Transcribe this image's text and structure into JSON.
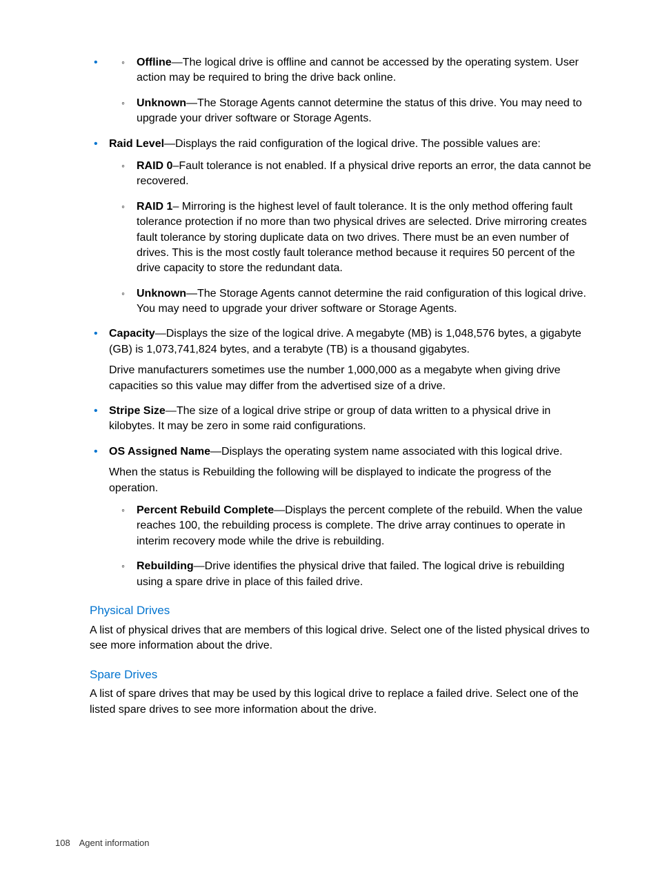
{
  "continuedSubItems": [
    {
      "term": "Offline",
      "desc": "—The logical drive is offline and cannot be accessed by the operating system. User action may be required to bring the drive back online."
    },
    {
      "term": "Unknown",
      "desc": "—The Storage Agents cannot determine the status of this drive. You may need to upgrade your driver software or Storage Agents."
    }
  ],
  "items": [
    {
      "term": "Raid Level",
      "desc": "—Displays the raid configuration of the logical drive. The possible values are:",
      "sub": [
        {
          "term": "RAID 0",
          "desc": "–Fault tolerance is not enabled. If a physical drive reports an error, the data cannot be recovered."
        },
        {
          "term": "RAID 1",
          "desc": "– Mirroring is the highest level of fault tolerance. It is the only method offering fault tolerance protection if no more than two physical drives are selected. Drive mirroring creates fault tolerance by storing duplicate data on two drives. There must be an even number of drives. This is the most costly fault tolerance method because it requires 50 percent of the drive capacity to store the redundant data."
        },
        {
          "term": "Unknown",
          "desc": "—The Storage Agents cannot determine the raid configuration of this logical drive. You may need to upgrade your driver software or Storage Agents."
        }
      ]
    },
    {
      "term": "Capacity",
      "desc": "—Displays the size of the logical drive. A megabyte (MB) is 1,048,576 bytes, a gigabyte (GB) is 1,073,741,824 bytes, and a terabyte (TB) is a thousand gigabytes.",
      "extra": "Drive manufacturers sometimes use the number 1,000,000 as a megabyte when giving drive capacities so this value may differ from the advertised size of a drive."
    },
    {
      "term": "Stripe Size",
      "desc": "—The size of a logical drive stripe or group of data written to a physical drive in kilobytes. It may be zero in some raid configurations."
    },
    {
      "term": "OS Assigned Name",
      "desc": "—Displays the operating system name associated with this logical drive.",
      "extra": "When the status is Rebuilding the following will be displayed to indicate the progress of the operation.",
      "sub": [
        {
          "term": "Percent Rebuild Complete",
          "desc": "—Displays the percent complete of the rebuild. When the value reaches 100, the rebuilding process is complete. The drive array continues to operate in interim recovery mode while the drive is rebuilding."
        },
        {
          "term": "Rebuilding",
          "desc": "—Drive identifies the physical drive that failed. The logical drive is rebuilding using a spare drive in place of this failed drive."
        }
      ]
    }
  ],
  "sections": [
    {
      "heading": "Physical Drives",
      "body": "A list of physical drives that are members of this logical drive. Select one of the listed physical drives to see more information about the drive."
    },
    {
      "heading": "Spare Drives",
      "body": "A list of spare drives that may be used by this logical drive to replace a failed drive. Select one of the listed spare drives to see more information about the drive."
    }
  ],
  "footer": {
    "page": "108",
    "title": "Agent information"
  }
}
